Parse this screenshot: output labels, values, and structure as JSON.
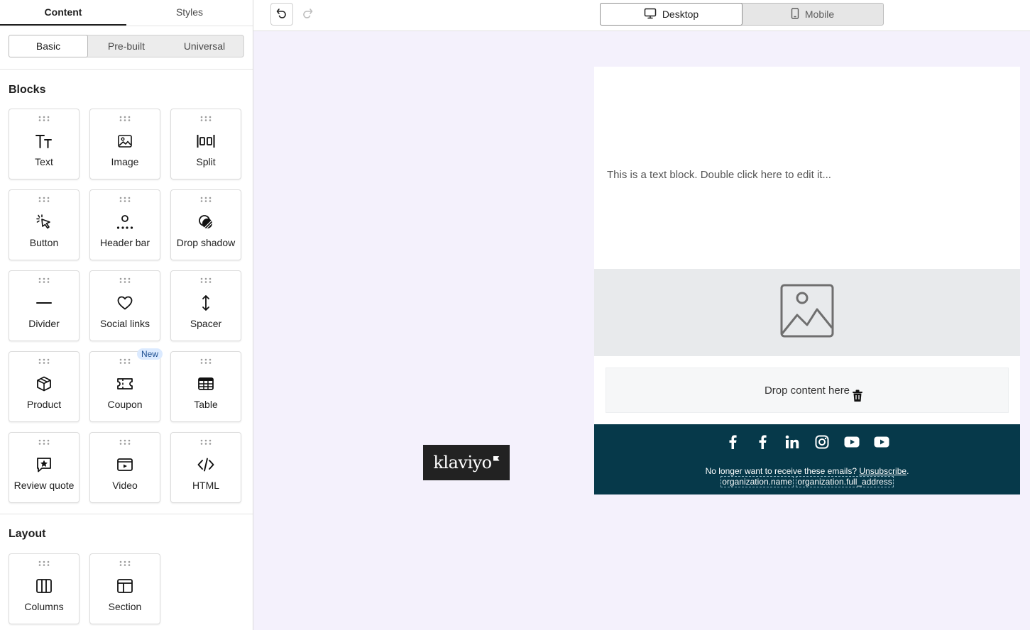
{
  "sidebar": {
    "tabs": [
      {
        "label": "Content",
        "active": true
      },
      {
        "label": "Styles",
        "active": false
      }
    ],
    "segments": [
      {
        "label": "Basic",
        "active": true
      },
      {
        "label": "Pre-built",
        "active": false
      },
      {
        "label": "Universal",
        "active": false
      }
    ],
    "blocks_title": "Blocks",
    "blocks": [
      {
        "label": "Text",
        "icon": "text-icon"
      },
      {
        "label": "Image",
        "icon": "image-icon"
      },
      {
        "label": "Split",
        "icon": "split-icon"
      },
      {
        "label": "Button",
        "icon": "cursor-click-icon"
      },
      {
        "label": "Header bar",
        "icon": "header-bar-icon"
      },
      {
        "label": "Drop shadow",
        "icon": "drop-shadow-icon"
      },
      {
        "label": "Divider",
        "icon": "divider-icon"
      },
      {
        "label": "Social links",
        "icon": "heart-icon"
      },
      {
        "label": "Spacer",
        "icon": "spacer-icon"
      },
      {
        "label": "Product",
        "icon": "box-icon"
      },
      {
        "label": "Coupon",
        "icon": "coupon-icon"
      },
      {
        "label": "Table",
        "icon": "table-icon"
      },
      {
        "label": "Review quote",
        "icon": "review-icon"
      },
      {
        "label": "Video",
        "icon": "video-icon"
      },
      {
        "label": "HTML",
        "icon": "code-icon"
      }
    ],
    "new_badge": "New",
    "layout_title": "Layout",
    "layout_blocks": [
      {
        "label": "Columns",
        "icon": "columns-icon"
      },
      {
        "label": "Section",
        "icon": "section-icon"
      }
    ]
  },
  "toolbar": {
    "undo_icon": "undo-icon",
    "redo_icon": "redo-icon",
    "devices": [
      {
        "label": "Desktop",
        "icon": "desktop-icon",
        "active": true
      },
      {
        "label": "Mobile",
        "icon": "mobile-icon",
        "active": false
      }
    ]
  },
  "email": {
    "text_block": "This is a text block. Double click here to edit it...",
    "image_placeholder_icon": "image-placeholder-icon",
    "drop_zone": "Drop content here",
    "drop_zone_icon": "trash-icon",
    "social_icons": [
      "facebook-icon",
      "facebook-icon",
      "linkedin-icon",
      "instagram-icon",
      "youtube-icon",
      "youtube-icon"
    ],
    "footer_text": "No longer want to receive these emails?",
    "unsubscribe": "Unsubscribe",
    "footer_period": ".",
    "org_name": "organization.name",
    "org_address": "organization.full_address",
    "footer_bg": "#06394a",
    "brand_logo": "klaviyo"
  }
}
